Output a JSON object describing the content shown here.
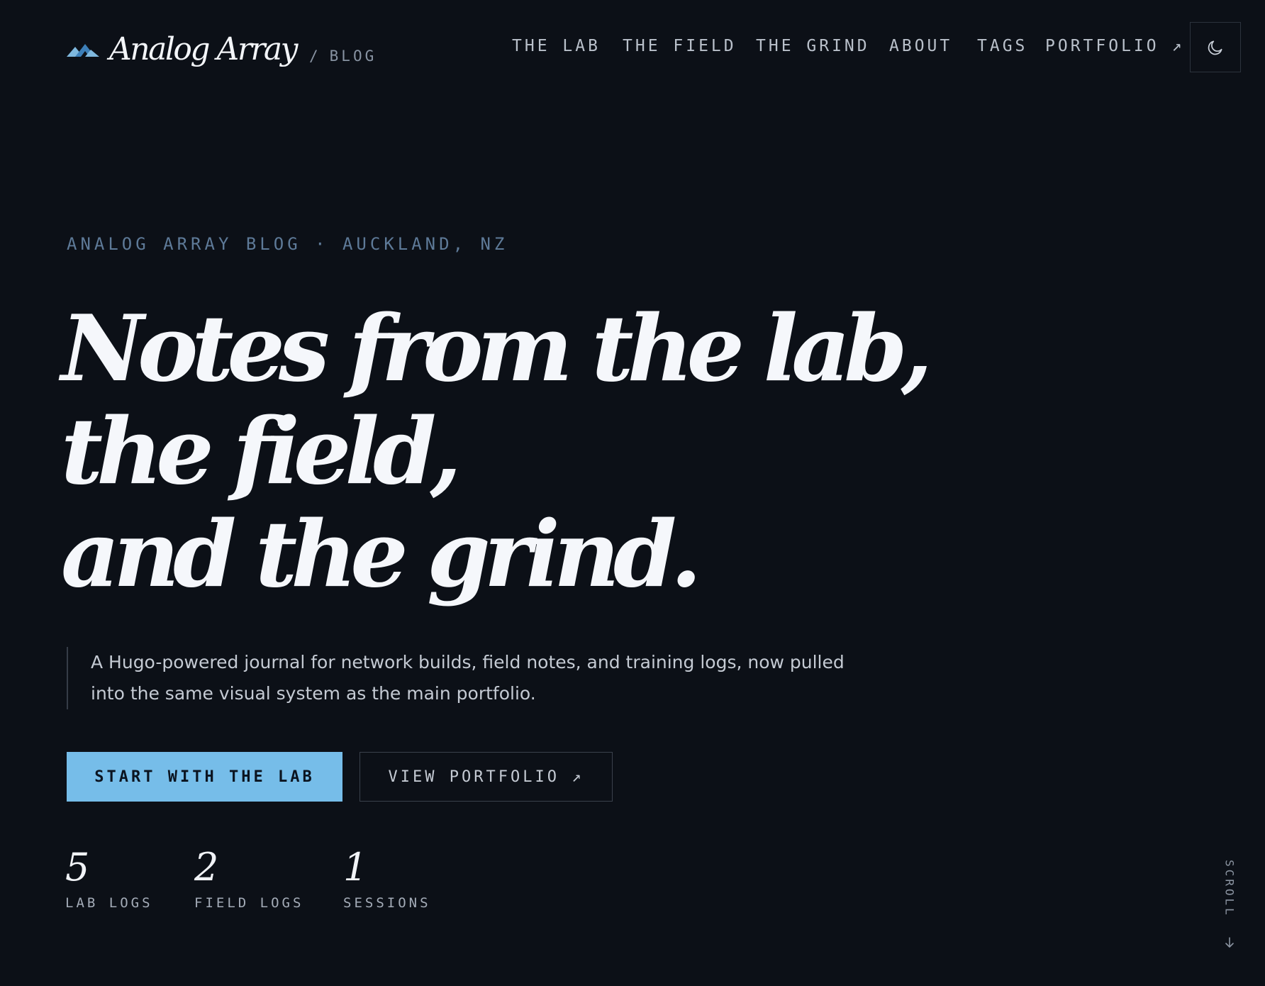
{
  "brand": {
    "name": "Analog Array",
    "separator": "/",
    "section": "BLOG",
    "logo_icon": "double-mountain-icon"
  },
  "nav": {
    "items": [
      {
        "label": "THE LAB"
      },
      {
        "label": "THE FIELD"
      },
      {
        "label": "THE GRIND"
      },
      {
        "label": "ABOUT"
      },
      {
        "label": "TAGS"
      },
      {
        "label": "PORTFOLIO ↗"
      }
    ],
    "theme_toggle_icon": "moon-icon"
  },
  "hero": {
    "eyebrow": "ANALOG ARRAY BLOG · AUCKLAND, NZ",
    "headline": [
      "Notes from the lab,",
      "the field,",
      "and the grind."
    ],
    "lede": "A Hugo-powered journal for network builds, field notes, and training logs, now pulled into the same visual system as the main portfolio.",
    "primary_button": "START WITH THE LAB",
    "secondary_button": "VIEW PORTFOLIO ↗"
  },
  "stats": [
    {
      "value": "5",
      "label": "LAB LOGS"
    },
    {
      "value": "2",
      "label": "FIELD LOGS"
    },
    {
      "value": "1",
      "label": "SESSIONS"
    }
  ],
  "scroll": {
    "label": "SCROLL",
    "icon": "arrow-down-icon"
  },
  "colors": {
    "background": "#0c1017",
    "accent": "#76bde9",
    "eyebrow": "#5e7a98",
    "text": "#f5f7fb"
  }
}
